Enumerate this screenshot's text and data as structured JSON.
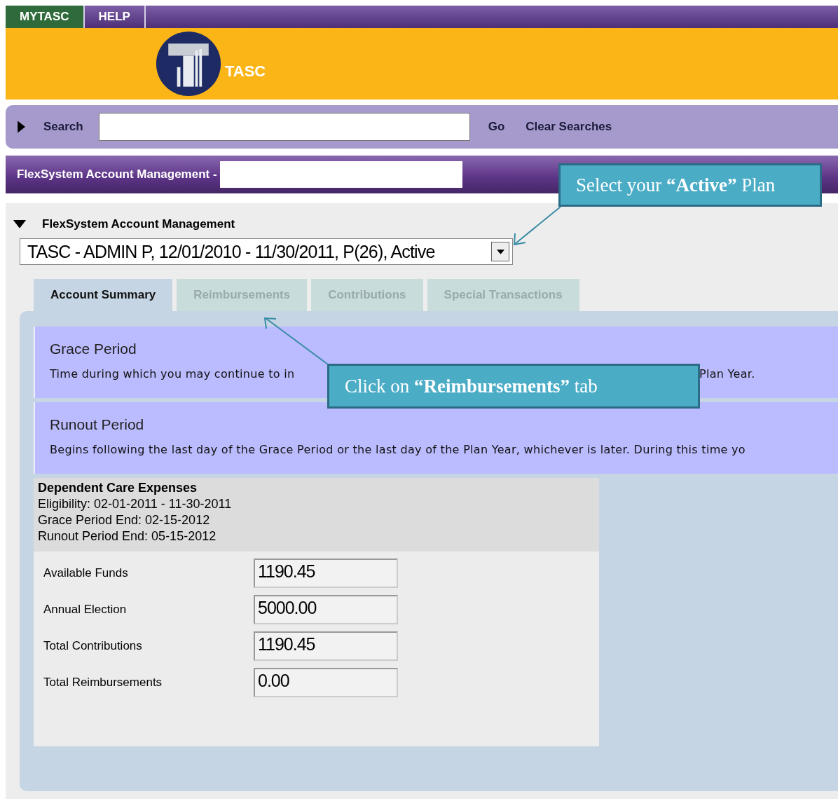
{
  "top_nav": [
    {
      "label": "MYTASC",
      "selected": true
    },
    {
      "label": "HELP",
      "selected": false
    }
  ],
  "logo": {
    "text": "TASC"
  },
  "search_bar": {
    "expanded": false,
    "label": "Search",
    "go": "Go",
    "clear": "Clear Searches"
  },
  "title_bar": {
    "title": "FlexSystem Account Management -"
  },
  "section": {
    "title": "FlexSystem Account Management",
    "expanded": true
  },
  "plan_dropdown": {
    "value": "TASC - ADMIN P, 12/01/2010 - 11/30/2011, P(26), Active"
  },
  "tabs": [
    {
      "label": "Account Summary",
      "selected": true
    },
    {
      "label": "Reimbursements",
      "selected": false
    },
    {
      "label": "Contributions",
      "selected": false
    },
    {
      "label": "Special Transactions",
      "selected": false
    }
  ],
  "info_boxes": [
    {
      "title": "Grace Period",
      "text_parts": [
        "Time during which you may continue to in",
        "Plan Year."
      ]
    },
    {
      "title": "Runout Period",
      "text_parts": [
        "Begins following the last day of the Grace Period or the last day of the Plan Year, whichever is later. During this time yo"
      ]
    }
  ],
  "account": {
    "heading": "Dependent Care Expenses",
    "details": [
      "Eligibility: 02-01-2011 - 11-30-2011",
      "Grace Period End: 02-15-2012",
      "Runout Period End: 05-15-2012"
    ],
    "fields": [
      {
        "label": "Available Funds",
        "value": "1190.45"
      },
      {
        "label": "Annual Election",
        "value": "5000.00"
      },
      {
        "label": "Total Contributions",
        "value": "1190.45"
      },
      {
        "label": "Total Reimbursements",
        "value": "0.00"
      }
    ]
  },
  "callouts": [
    "Select your **“Active”** Plan",
    "Click on **“Reimbursements”** tab"
  ]
}
